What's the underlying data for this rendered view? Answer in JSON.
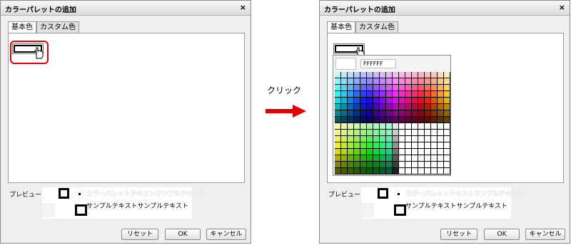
{
  "dialog": {
    "title": "カラーパレットの追加",
    "close_glyph": "×",
    "tabs": [
      {
        "label": "基本色"
      },
      {
        "label": "カスタム色"
      }
    ],
    "preview_label": "プレビュー",
    "preview_ghost_text": "カラーパレットテキストサンプルテキスト",
    "preview_text": "サンプルテキストサンプルテキスト",
    "buttons": {
      "reset": "リセット",
      "ok": "OK",
      "cancel": "キャンセル"
    }
  },
  "annotation": {
    "click_label": "クリック",
    "arrow_color": "#e30000",
    "highlight_color": "#e30000"
  },
  "picker": {
    "hex_value": "FFFFFF",
    "selected_color": "#ffffff"
  }
}
